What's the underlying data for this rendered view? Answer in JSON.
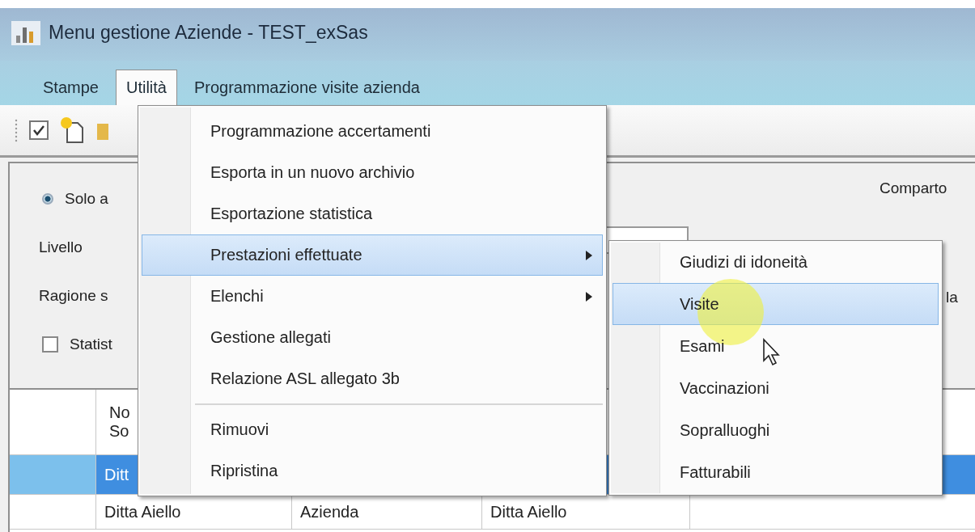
{
  "window": {
    "title": "Menu gestione Aziende - TEST_exSas"
  },
  "menu_bar": [
    {
      "label": "Stampe",
      "selected": false
    },
    {
      "label": "Utilità",
      "selected": true
    },
    {
      "label": "Programmazione visite azienda",
      "selected": false
    }
  ],
  "form": {
    "radio": {
      "label": "Solo a",
      "selected": true
    },
    "labels": [
      "Livello",
      "Ragione s"
    ],
    "checkbox": {
      "label": "Statist",
      "checked": false
    },
    "right_labels": [
      "Comparto",
      "la"
    ]
  },
  "grid": {
    "header": [
      "No",
      "So"
    ],
    "rows": [
      {
        "cells": [
          "Ditt"
        ],
        "selected": true
      },
      {
        "cells": [
          "Ditta Aiello",
          "Azienda",
          "Ditta Aiello"
        ],
        "selected": false
      }
    ]
  },
  "dropdown": {
    "items": [
      {
        "kind": "item",
        "label": "Programmazione accertamenti",
        "selected": false,
        "submenu": false
      },
      {
        "kind": "item",
        "label": "Esporta in un nuovo archivio",
        "selected": false,
        "submenu": false
      },
      {
        "kind": "item",
        "label": "Esportazione statistica",
        "selected": false,
        "submenu": false
      },
      {
        "kind": "item",
        "label": "Prestazioni effettuate",
        "selected": true,
        "submenu": true
      },
      {
        "kind": "item",
        "label": "Elenchi",
        "selected": false,
        "submenu": true
      },
      {
        "kind": "item",
        "label": "Gestione allegati",
        "selected": false,
        "submenu": false
      },
      {
        "kind": "item",
        "label": "Relazione ASL allegato 3b",
        "selected": false,
        "submenu": false
      },
      {
        "kind": "separator"
      },
      {
        "kind": "item",
        "label": "Rimuovi",
        "selected": false,
        "submenu": false
      },
      {
        "kind": "item",
        "label": "Ripristina",
        "selected": false,
        "submenu": false
      }
    ]
  },
  "submenu": {
    "items": [
      {
        "label": "Giudizi di idoneità",
        "selected": false
      },
      {
        "label": "Visite",
        "selected": true
      },
      {
        "label": "Esami",
        "selected": false
      },
      {
        "label": "Vaccinazioni",
        "selected": false
      },
      {
        "label": "Sopralluoghi",
        "selected": false
      },
      {
        "label": "Fatturabili",
        "selected": false
      }
    ]
  }
}
